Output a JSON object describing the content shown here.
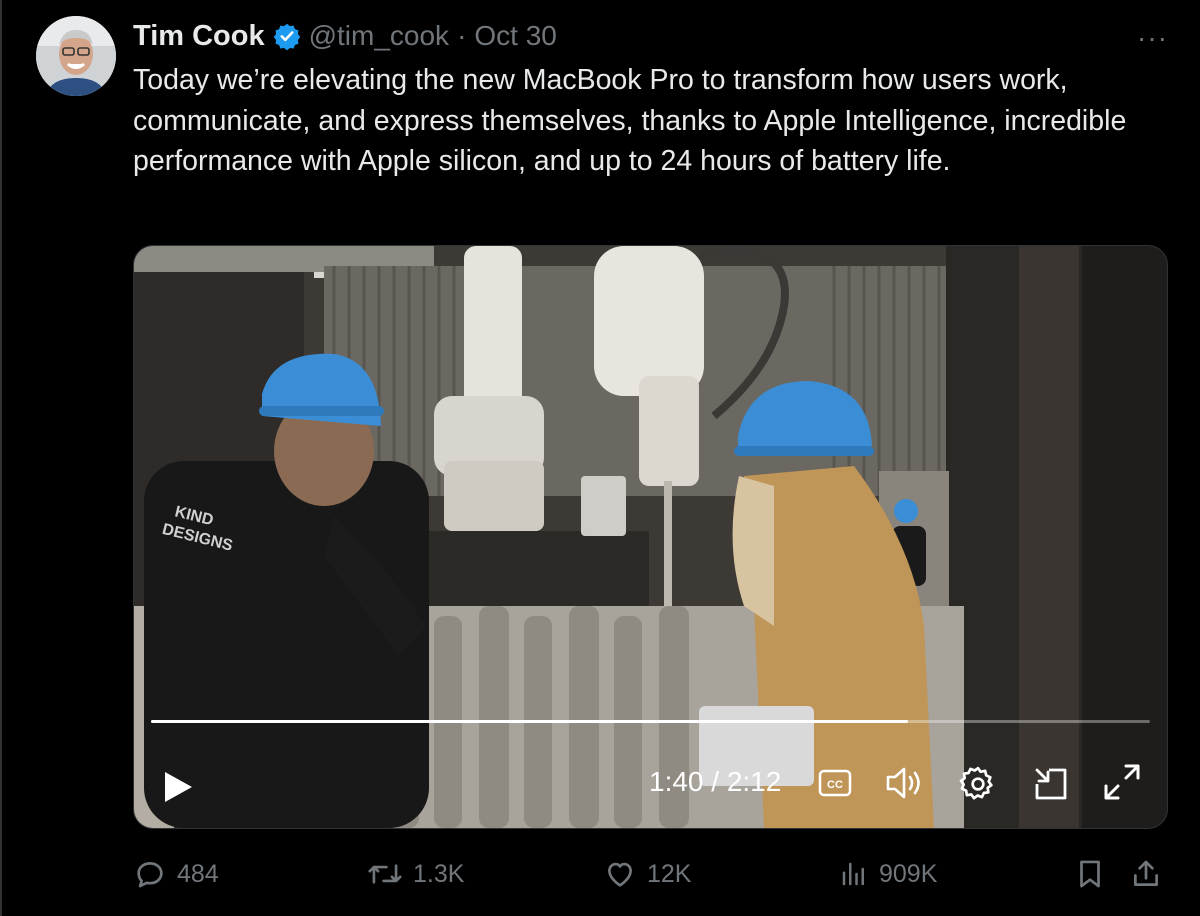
{
  "tweet": {
    "author": {
      "name": "Tim Cook",
      "handle": "@tim_cook",
      "separator": "·",
      "date": "Oct 30",
      "verified": true
    },
    "more_label": "···",
    "text": "Today we’re elevating the new MacBook Pro to transform how users work, communicate, and express themselves, thanks to Apple Intelligence, incredible performance with Apple silicon, and up to 24 hours of battery life."
  },
  "video": {
    "progress": 0.758,
    "time": "1:40 / 2:12",
    "cc_label": "CC",
    "shirt_text": [
      "KIND",
      "DESIGNS"
    ]
  },
  "actions": {
    "replies": "484",
    "reposts": "1.3K",
    "likes": "12K",
    "views": "909K"
  },
  "colors": {
    "text": "#e7e9ea",
    "secondary": "#71767b",
    "verified": "#1d9bf0",
    "background": "#000000",
    "hardhat": "#3b8ed6"
  },
  "icons": [
    "verified-icon",
    "more-icon",
    "play-icon",
    "closed-captions-icon",
    "volume-icon",
    "settings-gear-icon",
    "picture-in-picture-icon",
    "fullscreen-icon",
    "reply-icon",
    "repost-icon",
    "like-heart-icon",
    "views-icon",
    "bookmark-icon",
    "share-icon"
  ]
}
